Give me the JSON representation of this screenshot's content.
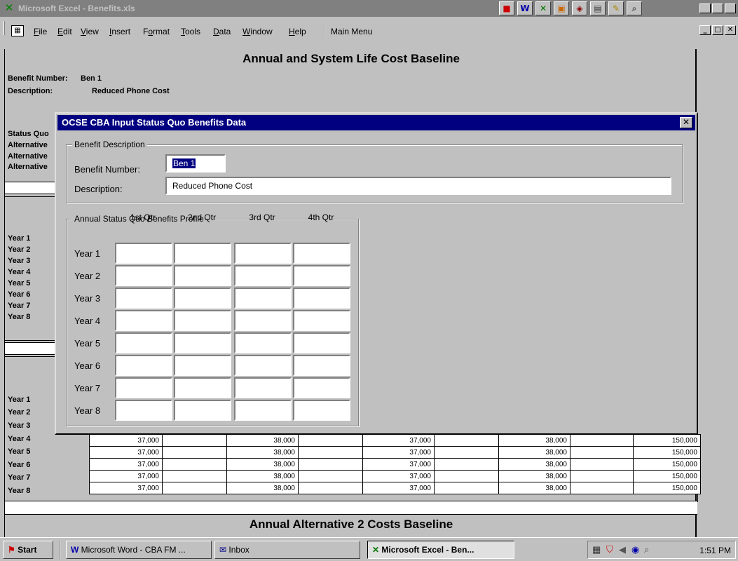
{
  "window": {
    "title": "Microsoft Excel - Benefits.xls",
    "toolbar_icons": [
      "color-palette-icon",
      "word-icon",
      "excel-icon",
      "powerpoint-icon",
      "access-icon",
      "binder-icon",
      "tools-icon",
      "find-icon"
    ],
    "buttons": {
      "minimize": "_",
      "maximize": "□",
      "close": "✕"
    }
  },
  "menubar": {
    "items": [
      "File",
      "Edit",
      "View",
      "Insert",
      "Format",
      "Tools",
      "Data",
      "Window",
      "Help"
    ],
    "accelerators": [
      "F",
      "E",
      "V",
      "I",
      "o",
      "T",
      "D",
      "W",
      "H"
    ],
    "main_menu": "Main Menu"
  },
  "sheet": {
    "title": "Annual and System Life Cost Baseline",
    "benefit_number_label": "Benefit Number:",
    "benefit_number_value": "Ben 1",
    "description_label": "Description:",
    "description_value": "Reduced Phone Cost",
    "side_labels": [
      "Status Quo",
      "Alternative",
      "Alternative",
      "Alternative"
    ],
    "year_labels_a": [
      "Year 1",
      "Year 2",
      "Year 3",
      "Year 4",
      "Year 5",
      "Year 6",
      "Year 7",
      "Year 8"
    ],
    "year_labels_b": [
      "Year 1",
      "Year 2",
      "Year 3",
      "Year 4",
      "Year 5",
      "Year 6",
      "Year 7",
      "Year 8"
    ],
    "data_rows": [
      {
        "q1": "37,000",
        "q2": "38,000",
        "q3": "37,000",
        "q4": "38,000",
        "total": "150,000"
      },
      {
        "q1": "37,000",
        "q2": "38,000",
        "q3": "37,000",
        "q4": "38,000",
        "total": "150,000"
      },
      {
        "q1": "37,000",
        "q2": "38,000",
        "q3": "37,000",
        "q4": "38,000",
        "total": "150,000"
      },
      {
        "q1": "37,000",
        "q2": "38,000",
        "q3": "37,000",
        "q4": "38,000",
        "total": "150,000"
      },
      {
        "q1": "37,000",
        "q2": "38,000",
        "q3": "37,000",
        "q4": "38,000",
        "total": "150,000"
      }
    ],
    "bottom_title": "Annual Alternative 2 Costs Baseline"
  },
  "dialog": {
    "title": "OCSE CBA Input Status Quo Benefits Data",
    "close": "✕",
    "benefit_group": "Benefit Description",
    "benefit_number_label": "Benefit Number:",
    "benefit_number_value": "Ben 1",
    "description_label": "Description:",
    "description_value": "Reduced Phone Cost",
    "profile_group": "Annual Status Quo Benefits Profile",
    "quarters": [
      "1st Qtr",
      "2nd Qtr",
      "3rd Qtr",
      "4th Qtr"
    ],
    "years": [
      "Year 1",
      "Year 2",
      "Year 3",
      "Year 4",
      "Year 5",
      "Year 6",
      "Year 7",
      "Year 8"
    ]
  },
  "taskbar": {
    "start": "Start",
    "tasks": [
      "Microsoft Word - CBA FM ...",
      "Inbox",
      "Microsoft Excel - Ben..."
    ],
    "clock": "1:51 PM"
  }
}
